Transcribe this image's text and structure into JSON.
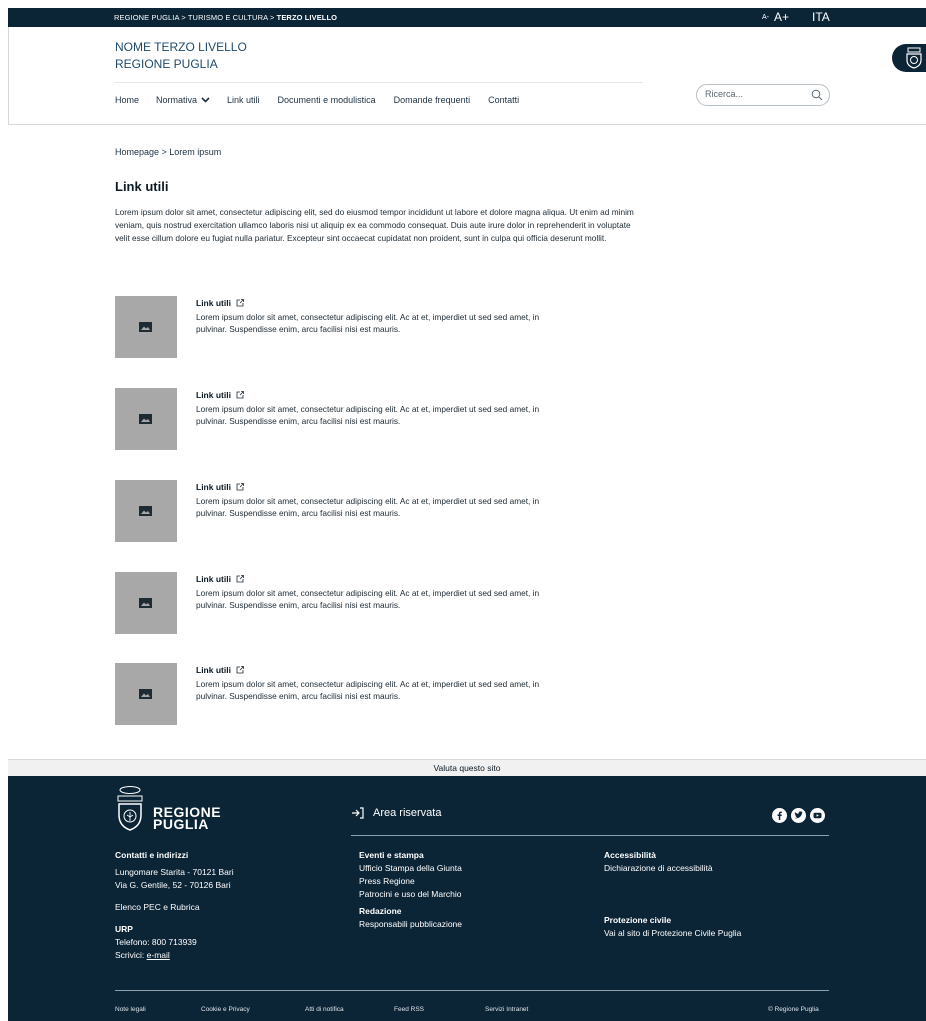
{
  "topbar": {
    "crumbs_prefix": "REGIONE PUGLIA > TURISMO E CULTURA > ",
    "crumbs_current": "TERZO LIVELLO",
    "font_smaller": "A-",
    "font_bigger": "A+",
    "language": "ITA"
  },
  "header": {
    "site_name_line1": "NOME TERZO LIVELLO",
    "site_name_line2": "REGIONE PUGLIA",
    "nav": [
      "Home",
      "Normativa",
      "Link utili",
      "Documenti e modulistica",
      "Domande frequenti",
      "Contatti"
    ],
    "search_placeholder": "Ricerca..."
  },
  "breadcrumb": "Homepage  >  Lorem ipsum",
  "page": {
    "title": "Link utili",
    "intro": "Lorem ipsum dolor sit amet, consectetur adipiscing elit, sed do eiusmod tempor incididunt ut labore et dolore magna aliqua. Ut enim ad minim veniam, quis nostrud exercitation ullamco laboris nisi ut aliquip ex ea commodo consequat. Duis aute irure dolor in reprehenderit in voluptate velit esse cillum dolore eu fugiat nulla pariatur. Excepteur sint occaecat cupidatat non proident, sunt in culpa qui officia deserunt mollit."
  },
  "links": [
    {
      "title": "Link utili",
      "desc": "Lorem ipsum dolor sit amet, consectetur adipiscing elit. Ac at et, imperdiet ut sed sed amet, in pulvinar. Suspendisse enim, arcu facilisi nisi est mauris."
    },
    {
      "title": "Link utili",
      "desc": "Lorem ipsum dolor sit amet, consectetur adipiscing elit. Ac at et, imperdiet ut sed sed amet, in pulvinar. Suspendisse enim, arcu facilisi nisi est mauris."
    },
    {
      "title": "Link utili",
      "desc": "Lorem ipsum dolor sit amet, consectetur adipiscing elit. Ac at et, imperdiet ut sed sed amet, in pulvinar. Suspendisse enim, arcu facilisi nisi est mauris."
    },
    {
      "title": "Link utili",
      "desc": "Lorem ipsum dolor sit amet, consectetur adipiscing elit. Ac at et, imperdiet ut sed sed amet, in pulvinar. Suspendisse enim, arcu facilisi nisi est mauris."
    },
    {
      "title": "Link utili",
      "desc": "Lorem ipsum dolor sit amet, consectetur adipiscing elit. Ac at et, imperdiet ut sed sed amet, in pulvinar. Suspendisse enim, arcu facilisi nisi est mauris."
    }
  ],
  "footer": {
    "rate": "Valuta questo sito",
    "logo_line1": "REGIONE",
    "logo_line2": "PUGLIA",
    "area_riservata": "Area riservata",
    "contatti": {
      "heading": "Contatti e indirizzi",
      "addr1": "Lungomare Starita - 70121 Bari",
      "addr2": "Via G. Gentile, 52 - 70126 Bari",
      "pec": "Elenco PEC e Rubrica",
      "urp_heading": "URP",
      "phone": "Telefono: 800 713939",
      "write_prefix": "Scrivici: ",
      "write_link": "e-mail"
    },
    "eventi": {
      "heading": "Eventi e stampa",
      "items": [
        "Ufficio Stampa della Giunta",
        "Press Regione",
        "Patrocini e uso del Marchio"
      ],
      "redazione_heading": "Redazione",
      "redazione_item": "Responsabili pubblicazione"
    },
    "accessibilita": {
      "heading": "Accessibilità",
      "item": "Dichiarazione di accessibilità",
      "protezione_heading": "Protezione civile",
      "protezione_item": "Vai al sito di Protezione Civile Puglia"
    },
    "bottom_links": [
      "Note legali",
      "Cookie e Privacy",
      "Atti di notifica",
      "Feed RSS",
      "Servizi Intranet"
    ],
    "copyright": "© Regione Puglia"
  },
  "icons": {
    "nav_dropdown": "chevron-down-icon",
    "search": "search-icon",
    "external": "external-link-icon",
    "image": "image-placeholder-icon",
    "login": "login-arrow-icon",
    "social": [
      "facebook-icon",
      "twitter-icon",
      "youtube-icon"
    ]
  }
}
